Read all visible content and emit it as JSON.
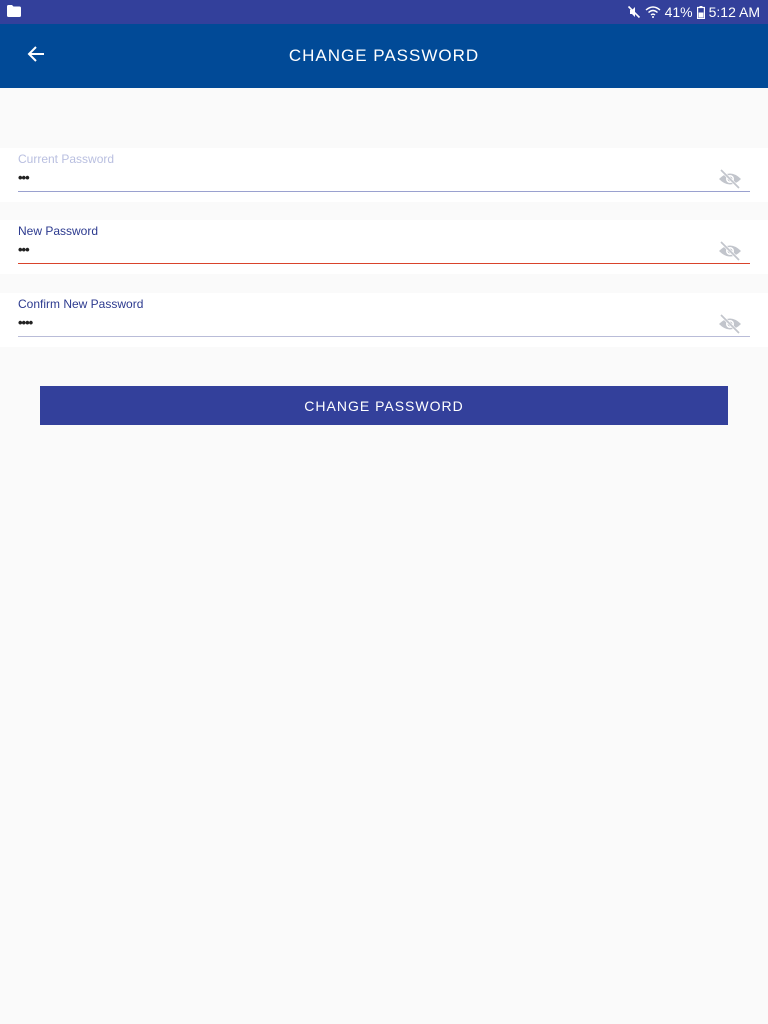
{
  "status_bar": {
    "left_icon": "folder-icon",
    "mute_icon": "mute-icon",
    "wifi_icon": "wifi-icon",
    "battery_percent": "41%",
    "battery_icon": "battery-icon",
    "time": "5:12 AM"
  },
  "app_bar": {
    "back_icon": "arrow-left-icon",
    "title": "CHANGE PASSWORD",
    "background": "#014a97"
  },
  "form": {
    "current_password": {
      "label": "Current Password",
      "value": "•••"
    },
    "new_password": {
      "label": "New Password",
      "value": "•••"
    },
    "confirm_password": {
      "label": "Confirm New Password",
      "value": "••••"
    },
    "toggle_icon": "eye-off-icon"
  },
  "submit": {
    "label": "CHANGE PASSWORD",
    "background": "#33409b"
  },
  "colors": {
    "status_bar": "#33409b",
    "error_underline": "#d9432b",
    "label": "#2c3a8f"
  }
}
